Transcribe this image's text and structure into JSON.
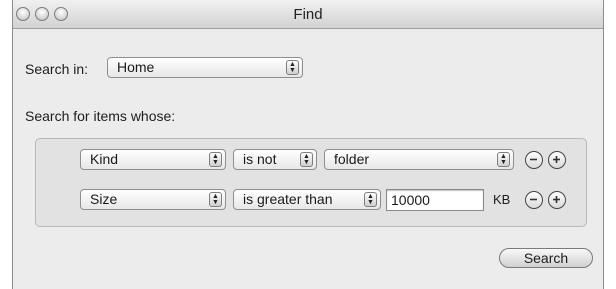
{
  "window": {
    "title": "Find"
  },
  "search_in": {
    "label": "Search in:",
    "value": "Home"
  },
  "criteria_heading": "Search for items whose:",
  "rows": [
    {
      "attribute": "Kind",
      "operator": "is not",
      "value": "folder"
    },
    {
      "attribute": "Size",
      "operator": "is greater than",
      "value": "10000",
      "unit": "KB"
    }
  ],
  "search_button": "Search",
  "icons": {
    "close": "close-icon",
    "minimize": "minimize-icon",
    "zoom": "zoom-icon",
    "remove": "minus-circle-icon",
    "add": "plus-circle-icon",
    "popup": "updown-arrows-icon"
  }
}
